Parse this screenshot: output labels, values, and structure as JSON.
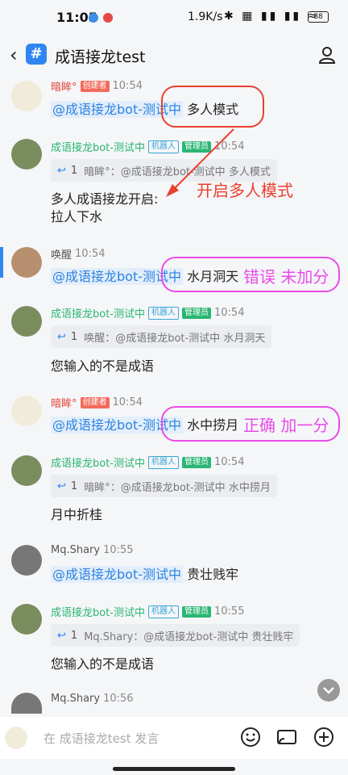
{
  "status": {
    "time": "11:05",
    "speed": "1.9K/s",
    "icons": "✱ ▦ ▮▮ ▮▮ ≈",
    "battery": "88"
  },
  "header": {
    "title": "成语接龙test",
    "hash_icon": "#",
    "back_icon": "‹"
  },
  "messages": [
    {
      "name": "暗眸°",
      "tags": [
        "创建者"
      ],
      "time": "10:54",
      "mention": "@成语接龙bot-测试中",
      "text": " 多人模式"
    },
    {
      "name": "成语接龙bot-测试中",
      "tags": [
        "机器人",
        "管理员"
      ],
      "time": "10:54",
      "reply_count": "1",
      "reply": "暗眸°：@成语接龙bot-测试中 多人模式",
      "lines": [
        "多人成语接龙开启:",
        "拉人下水"
      ]
    },
    {
      "name": "唤醒",
      "time": "10:54",
      "mention": "@成语接龙bot-测试中",
      "text": " 水月洞天"
    },
    {
      "name": "成语接龙bot-测试中",
      "tags": [
        "机器人",
        "管理员"
      ],
      "time": "10:54",
      "reply_count": "1",
      "reply": "唤醒：@成语接龙bot-测试中 水月洞天",
      "lines": [
        "您输入的不是成语"
      ]
    },
    {
      "name": "暗眸°",
      "tags": [
        "创建者"
      ],
      "time": "10:54",
      "mention": "@成语接龙bot-测试中",
      "text": " 水中捞月"
    },
    {
      "name": "成语接龙bot-测试中",
      "tags": [
        "机器人",
        "管理员"
      ],
      "time": "10:54",
      "reply_count": "1",
      "reply": "暗眸°：@成语接龙bot-测试中 水中捞月",
      "lines": [
        "月中折桂"
      ]
    },
    {
      "name": "Mq.Shary",
      "time": "10:55",
      "mention": "@成语接龙bot-测试中",
      "text": " 贵壮贱牢"
    },
    {
      "name": "成语接龙bot-测试中",
      "tags": [
        "机器人",
        "管理员"
      ],
      "time": "10:55",
      "reply_count": "1",
      "reply": "Mq.Shary：@成语接龙bot-测试中 贵壮贱牢",
      "lines": [
        "您输入的不是成语"
      ]
    },
    {
      "name": "Mq.Shary",
      "time": "10:56"
    }
  ],
  "annotations": {
    "a1": "开启多人模式",
    "a2": "错误 未加分",
    "a3": "正确 加一分"
  },
  "input": {
    "placeholder": "在 成语接龙test 发言"
  },
  "colors": {
    "accent": "#2f86f2",
    "annotation_red": "#e9402f",
    "annotation_pink": "#e84be8",
    "bot_green": "#2bb673"
  }
}
